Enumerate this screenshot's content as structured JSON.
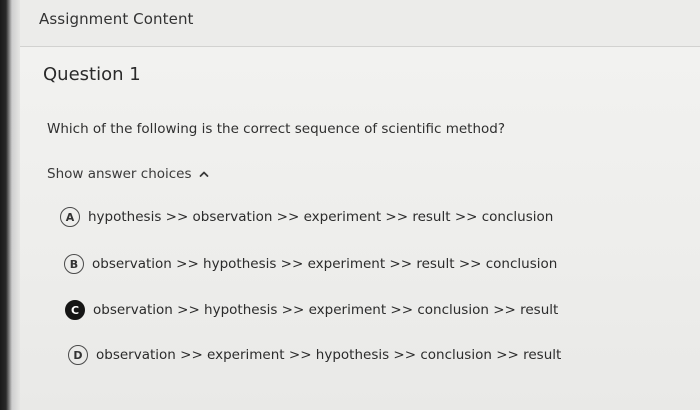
{
  "header": {
    "title": "Assignment Content"
  },
  "question": {
    "title": "Question 1",
    "prompt": "Which of the following is the correct sequence of scientific method?",
    "toggle_label": "Show answer choices",
    "toggle_icon": "chevron-up-icon",
    "choices": [
      {
        "letter": "A",
        "text": "hypothesis >> observation >> experiment >> result >> conclusion",
        "selected": false
      },
      {
        "letter": "B",
        "text": "observation >> hypothesis >> experiment >> result >> conclusion",
        "selected": false
      },
      {
        "letter": "C",
        "text": "observation >> hypothesis >> experiment >> conclusion >> result",
        "selected": true
      },
      {
        "letter": "D",
        "text": "observation >> experiment >> hypothesis >> conclusion >> result",
        "selected": false
      }
    ]
  },
  "colors": {
    "selected_badge": "#151515",
    "page_background": "#ececea"
  }
}
